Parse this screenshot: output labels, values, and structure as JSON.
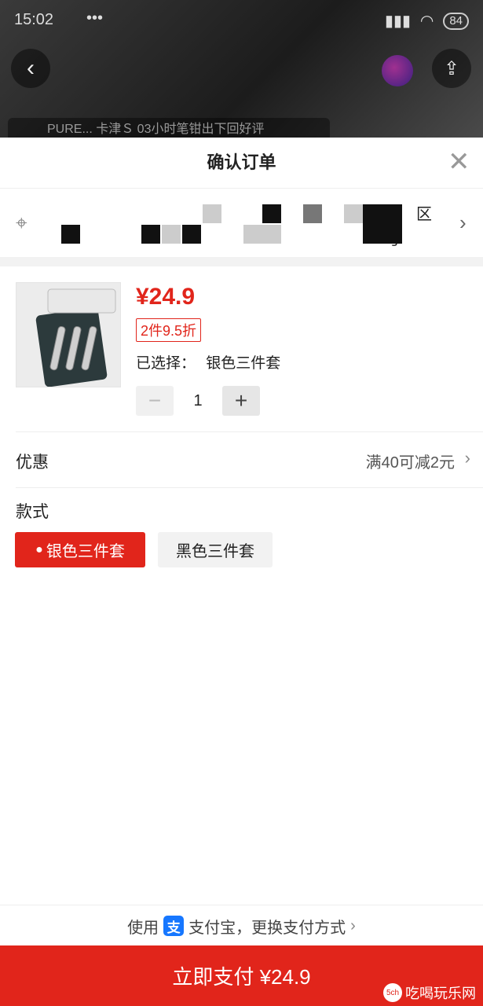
{
  "status_bar": {
    "time": "15:02",
    "dots": "•••",
    "battery": "84"
  },
  "backdrop": {
    "banner_text": "PURE... 卡津Ｓ 03小时笔钳出下回好评"
  },
  "sheet": {
    "title": "确认订单",
    "address": {
      "line1": "区",
      "line2": "号"
    },
    "product": {
      "price": "¥24.9",
      "discount_tag": "2件9.5折",
      "selected_label": "已选择：",
      "selected_value": "银色三件套",
      "quantity": "1",
      "minus": "−",
      "plus": "+"
    },
    "promo": {
      "label": "优惠",
      "value": "满40可减2元"
    },
    "style": {
      "title": "款式",
      "options": [
        {
          "label": "银色三件套",
          "active": true
        },
        {
          "label": "黑色三件套",
          "active": false
        }
      ]
    },
    "payment": {
      "prefix": "使用",
      "alipay_icon_text": "支",
      "suffix": "支付宝，更换支付方式",
      "pay_button": "立即支付 ¥24.9"
    }
  },
  "watermark": {
    "text": "吃喝玩乐网",
    "icon_text": "5ch"
  },
  "colors": {
    "accent": "#e1251b",
    "alipay": "#1677ff"
  }
}
